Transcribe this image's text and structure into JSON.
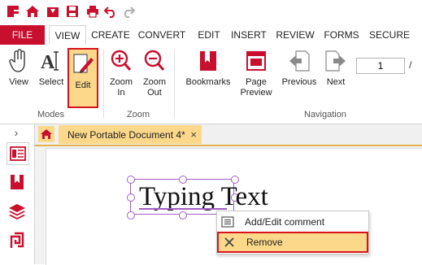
{
  "quick_access": {
    "icons": [
      "app-logo-icon",
      "home-icon",
      "open-icon",
      "save-icon",
      "print-icon",
      "undo-icon",
      "redo-icon"
    ]
  },
  "tabs": {
    "file": "FILE",
    "items": [
      "VIEW",
      "CREATE",
      "CONVERT",
      "EDIT",
      "INSERT",
      "REVIEW",
      "FORMS",
      "SECURE"
    ],
    "active": "VIEW"
  },
  "ribbon": {
    "view": "View",
    "select": "Select",
    "edit": "Edit",
    "zoom_in_1": "Zoom",
    "zoom_in_2": "In",
    "zoom_out_1": "Zoom",
    "zoom_out_2": "Out",
    "bookmarks": "Bookmarks",
    "page_preview_1": "Page",
    "page_preview_2": "Preview",
    "previous": "Previous",
    "next": "Next",
    "page_number": "1",
    "page_sep": "/",
    "groups": {
      "modes": "Modes",
      "zoom": "Zoom",
      "navigation": "Navigation"
    }
  },
  "sidebar": {
    "collapse": "›",
    "icons": [
      "pages-panel-icon",
      "bookmarks-panel-icon",
      "layers-panel-icon",
      "attachments-panel-icon"
    ]
  },
  "doc_tab": {
    "title": "New Portable Document 4*",
    "close": "×"
  },
  "document": {
    "text": "Typing Text"
  },
  "context_menu": {
    "items": [
      {
        "label": "Add/Edit comment",
        "icon": "comment-icon"
      },
      {
        "label": "Remove",
        "icon": "remove-icon"
      }
    ]
  },
  "colors": {
    "brand": "#c8102e",
    "highlight": "#fbd88a",
    "highlight_border": "#d7141a",
    "selection": "#a25fc2"
  }
}
